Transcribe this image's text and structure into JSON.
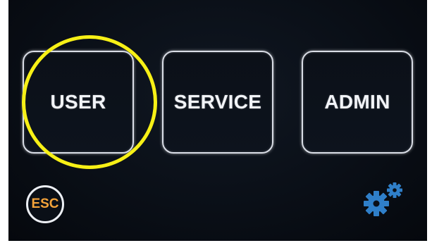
{
  "tiles": {
    "user": "USER",
    "service": "SERVICE",
    "admin": "ADMIN"
  },
  "esc_label": "ESC",
  "icons": {
    "settings": "gear-icon"
  },
  "colors": {
    "highlight": "#f7f016",
    "esc_text": "#f4a33a",
    "gear": "#2f7fc9",
    "tile_border": "#d9dde6",
    "screen_bg": "#0a0f17"
  }
}
